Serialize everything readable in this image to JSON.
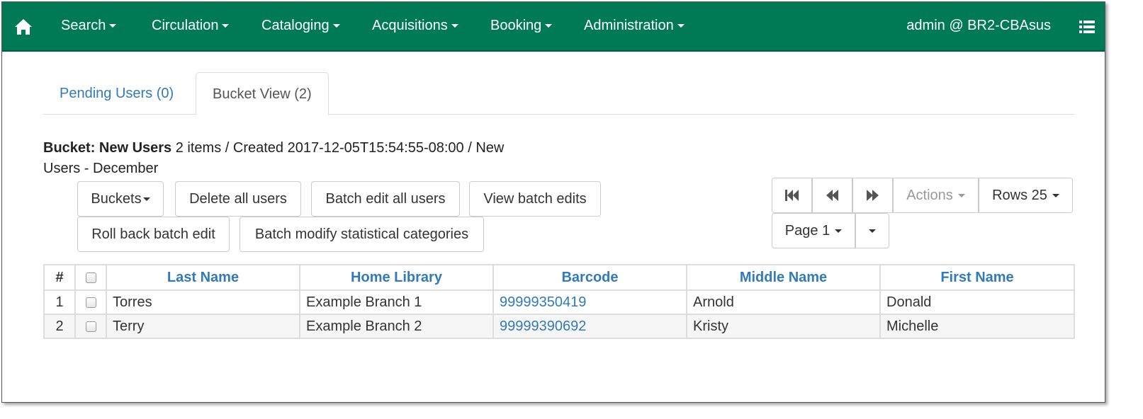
{
  "navbar": {
    "home_icon": "home-icon",
    "items": [
      {
        "label": "Search"
      },
      {
        "label": "Circulation"
      },
      {
        "label": "Cataloging"
      },
      {
        "label": "Acquisitions"
      },
      {
        "label": "Booking"
      },
      {
        "label": "Administration"
      }
    ],
    "user": "admin @ BR2-CBAsus",
    "menu_icon": "list-icon",
    "bg_color": "#007a54"
  },
  "tabs": [
    {
      "label": "Pending Users (0)",
      "active": false
    },
    {
      "label": "Bucket View (2)",
      "active": true
    }
  ],
  "bucket": {
    "title": "Bucket: New Users",
    "details": "2 items / Created 2017-12-05T15:54:55-08:00 / New Users - December"
  },
  "toolbar": {
    "buckets": "Buckets",
    "delete_all": "Delete all users",
    "batch_edit_all": "Batch edit all users",
    "view_batch_edits": "View batch edits",
    "roll_back": "Roll back batch edit",
    "batch_modify": "Batch modify statistical categories"
  },
  "pager": {
    "first_icon": "first-page-icon",
    "prev_icon": "previous-page-icon",
    "next_icon": "next-page-icon",
    "actions": "Actions",
    "rows": "Rows 25",
    "page": "Page 1"
  },
  "table": {
    "columns": [
      "#",
      "",
      "Last Name",
      "Home Library",
      "Barcode",
      "Middle Name",
      "First Name"
    ],
    "rows": [
      {
        "num": "1",
        "last": "Torres",
        "library": "Example Branch 1",
        "barcode": "99999350419",
        "middle": "Arnold",
        "first": "Donald"
      },
      {
        "num": "2",
        "last": "Terry",
        "library": "Example Branch 2",
        "barcode": "99999390692",
        "middle": "Kristy",
        "first": "Michelle"
      }
    ]
  },
  "colors": {
    "link": "#337ab7",
    "accent": "#007a54"
  }
}
